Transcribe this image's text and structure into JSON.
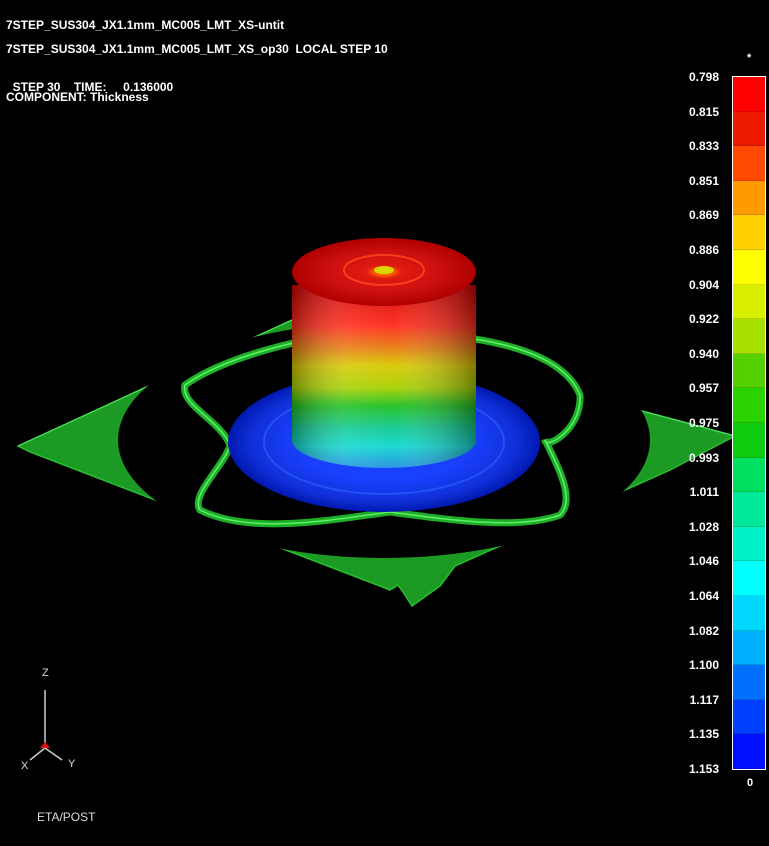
{
  "header": {
    "line1": "7STEP_SUS304_JX1.1mm_MC005_LMT_XS-untit",
    "line2": "7STEP_SUS304_JX1.1mm_MC005_LMT_XS_op30  LOCAL STEP 10",
    "step_label": "STEP 30",
    "time_label": "TIME:",
    "time_value": "0.136000",
    "component_label": "COMPONENT: Thickness"
  },
  "legend": {
    "top_marker": "*",
    "bottom_marker": "0",
    "values": [
      "0.798",
      "0.815",
      "0.833",
      "0.851",
      "0.869",
      "0.886",
      "0.904",
      "0.922",
      "0.940",
      "0.957",
      "0.975",
      "0.993",
      "1.011",
      "1.028",
      "1.046",
      "1.064",
      "1.082",
      "1.100",
      "1.117",
      "1.135",
      "1.153"
    ],
    "colors": [
      "#ff0000",
      "#ee1a00",
      "#ff4a00",
      "#ff9a00",
      "#ffd000",
      "#ffff00",
      "#d8f000",
      "#a8e000",
      "#55d000",
      "#2ad400",
      "#10cc10",
      "#00e060",
      "#00e89a",
      "#00f0c8",
      "#00ffff",
      "#00d8ff",
      "#00b0ff",
      "#0070ff",
      "#0040ff",
      "#0010ff"
    ]
  },
  "triad": {
    "z": "Z",
    "x": "X",
    "y": "Y"
  },
  "footer": {
    "brand": "ETA/POST"
  }
}
